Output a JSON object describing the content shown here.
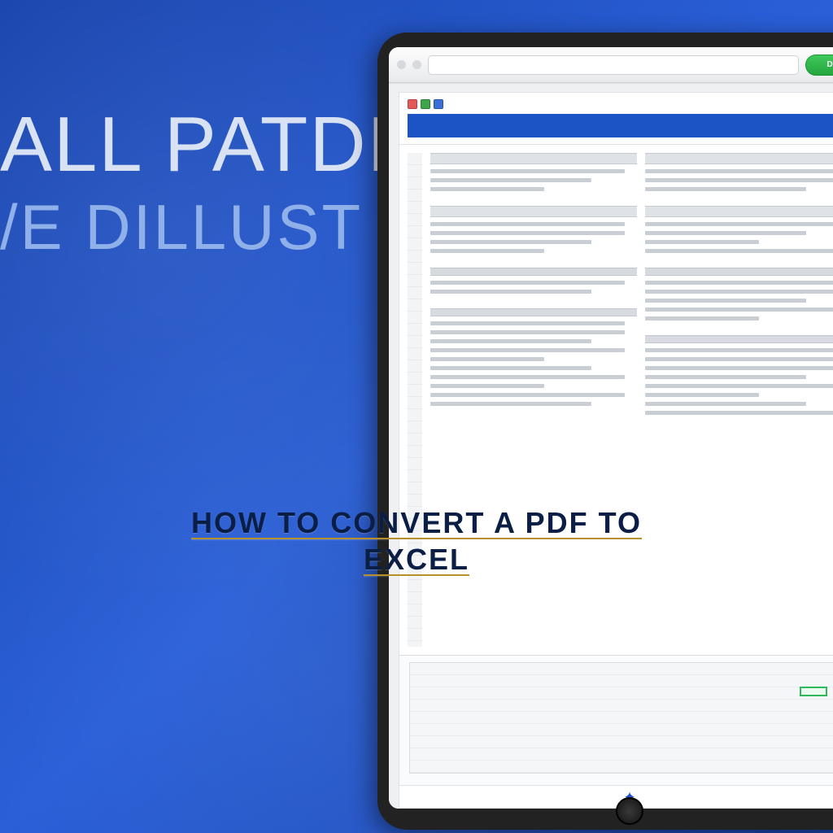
{
  "headline": "all Patde",
  "subhead": "/e DIllust",
  "caption_line1": "HOW TO CONVERT A PDF TO",
  "caption_line2": "EXCEL",
  "browser": {
    "action_label": "Del"
  }
}
